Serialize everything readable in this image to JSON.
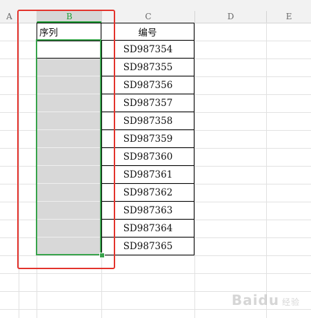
{
  "columns": [
    "A",
    "B",
    "C",
    "D",
    "E"
  ],
  "header_row": {
    "b_label": "序列",
    "c_label": "编号"
  },
  "c_values": [
    "SD987354",
    "SD987355",
    "SD987356",
    "SD987357",
    "SD987358",
    "SD987359",
    "SD987360",
    "SD987361",
    "SD987362",
    "SD987363",
    "SD987364",
    "SD987365"
  ],
  "watermark": {
    "text": "Baidu",
    "sub": "经验"
  },
  "colors": {
    "selection": "#37a34a",
    "highlight_box": "#e3322b",
    "selected_fill": "#d8d8d8"
  }
}
